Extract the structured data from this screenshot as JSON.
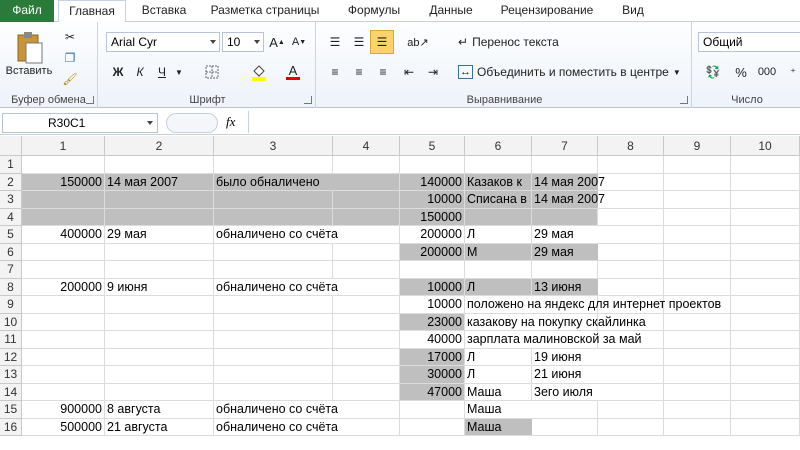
{
  "tabs": [
    "Файл",
    "Главная",
    "Вставка",
    "Разметка страницы",
    "Формулы",
    "Данные",
    "Рецензирование",
    "Вид"
  ],
  "ribbon": {
    "clipboard": {
      "paste_label": "Вставить",
      "group_label": "Буфер обмена"
    },
    "font": {
      "font_name": "Arial Cyr",
      "font_size": "10",
      "bold": "Ж",
      "italic": "К",
      "underline": "Ч",
      "group_label": "Шрифт"
    },
    "alignment": {
      "wrap_text": "Перенос текста",
      "merge_center": "Объединить и поместить в центре",
      "group_label": "Выравнивание"
    },
    "number": {
      "format": "Общий",
      "percent": "%",
      "thousands": "000",
      "group_label": "Число"
    }
  },
  "formula_bar": {
    "name_box": "R30C1",
    "fx": "fx",
    "content": ""
  },
  "columns": [
    "1",
    "2",
    "3",
    "4",
    "5",
    "6",
    "7",
    "8",
    "9",
    "10"
  ],
  "rows": [
    "1",
    "2",
    "3",
    "4",
    "5",
    "6",
    "7",
    "8",
    "9",
    "10",
    "11",
    "12",
    "13",
    "14",
    "15",
    "16"
  ],
  "cells": {
    "r2c1": "150000",
    "r2c2": "14 мая 2007",
    "r2c3": "было обналичено",
    "r2c5": "140000",
    "r2c6": "Казаков к",
    "r2c7": "14 мая 2007",
    "r3c5": "10000",
    "r3c6": "Списана в",
    "r3c7": "14 мая 2007",
    "r4c5": "150000",
    "r5c1": "400000",
    "r5c2": "29 мая",
    "r5c3": "обналичено со счёта",
    "r5c5": "200000",
    "r5c6": "Л",
    "r5c7": "29 мая",
    "r6c5": "200000",
    "r6c6": "М",
    "r6c7": "29 мая",
    "r8c1": "200000",
    "r8c2": "9 июня",
    "r8c3": "обналичено со счёта",
    "r8c5": "10000",
    "r8c6": "Л",
    "r8c7": "13 июня",
    "r9c5": "10000",
    "r9c6": "положено на яндекс для интернет проектов",
    "r10c5": "23000",
    "r10c6": "казакову на покупку скайлинка",
    "r11c5": "40000",
    "r11c6": "зарплата малиновской за май",
    "r12c5": "17000",
    "r12c6": "Л",
    "r12c7": "19 июня",
    "r13c5": "30000",
    "r13c6": "Л",
    "r13c7": "21 июня",
    "r14c5": "47000",
    "r14c6": "Маша",
    "r14c7": "3его июля",
    "r15c1": "900000",
    "r15c2": "8 августа",
    "r15c3": "обналичено со счёта",
    "r15c6": "Маша",
    "r16c1": "500000",
    "r16c2": "21 августа",
    "r16c3": "обналичено со счёта",
    "r16c6": "Маша"
  },
  "colors": {
    "file_tab": "#2a7a3a",
    "highlight": "#bfbfbf",
    "grid_line": "#dadcdd"
  }
}
